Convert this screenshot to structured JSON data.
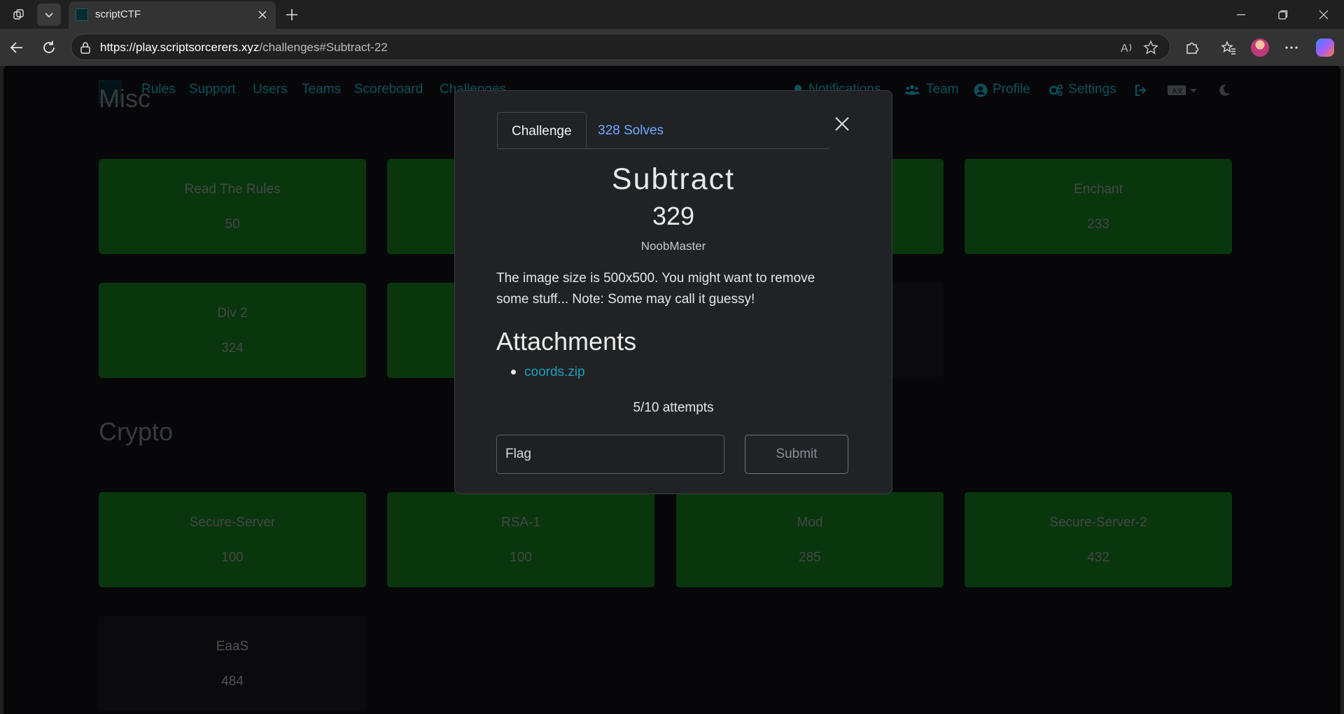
{
  "browser": {
    "tab_title": "scriptCTF",
    "url_host": "https://play.scriptsorcerers.xyz",
    "url_path": "/challenges#Subtract-22"
  },
  "site_nav": {
    "left": [
      "Rules",
      "Support",
      "Users",
      "Teams",
      "Scoreboard",
      "Challenges"
    ],
    "notifications": "Notifications",
    "team": "Team",
    "profile": "Profile",
    "settings": "Settings"
  },
  "sections": [
    {
      "title": "Misc",
      "cards": [
        {
          "name": "Read The Rules",
          "value": "50",
          "solved": true
        },
        {
          "name": "",
          "value": "",
          "solved": true
        },
        {
          "name": "",
          "value": "",
          "solved": true
        },
        {
          "name": "Enchant",
          "value": "233",
          "solved": true
        },
        {
          "name": "Div 2",
          "value": "324",
          "solved": true
        },
        {
          "name": "",
          "value": "",
          "solved": true
        },
        {
          "name": "",
          "value": "",
          "solved": false
        }
      ]
    },
    {
      "title": "Crypto",
      "cards": [
        {
          "name": "Secure-Server",
          "value": "100",
          "solved": true
        },
        {
          "name": "RSA-1",
          "value": "100",
          "solved": true
        },
        {
          "name": "Mod",
          "value": "285",
          "solved": true
        },
        {
          "name": "Secure-Server-2",
          "value": "432",
          "solved": true
        },
        {
          "name": "EaaS",
          "value": "484",
          "solved": false
        }
      ]
    }
  ],
  "modal": {
    "tab_challenge": "Challenge",
    "tab_solves": "328 Solves",
    "name": "Subtract",
    "value": "329",
    "author": "NoobMaster",
    "description": "The image size is 500x500. You might want to remove some stuff... Note: Some may call it guessy!",
    "attachments_heading": "Attachments",
    "attachments": [
      "coords.zip"
    ],
    "attempts": "5/10 attempts",
    "flag_placeholder": "Flag",
    "submit_label": "Submit"
  },
  "colors": {
    "solved_card": "#136d1b",
    "link": "#17a2b8",
    "solves_tab": "#6ea8fe"
  }
}
